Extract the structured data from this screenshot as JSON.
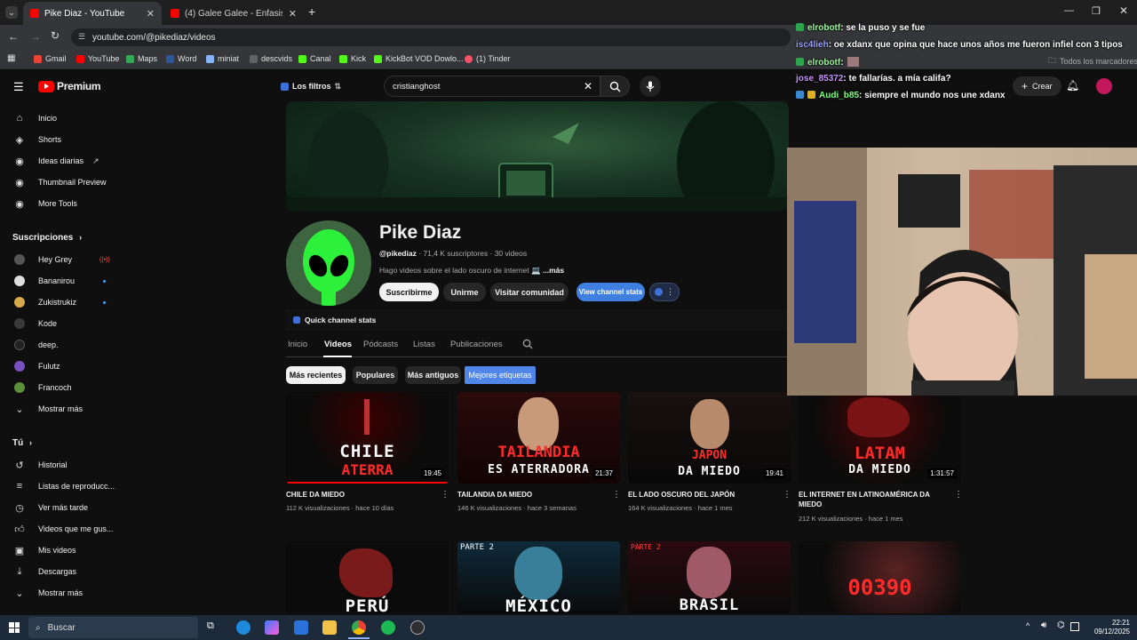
{
  "browser": {
    "tabs": [
      {
        "title": "Pike Diaz - YouTube",
        "active": true
      },
      {
        "title": "(4) Galee Galee - Énfasis (Vídeo",
        "active": false
      }
    ],
    "url": "youtube.com/@pikediaz/videos",
    "bookmarks": [
      "Gmail",
      "YouTube",
      "Maps",
      "Word",
      "miniat",
      "descvids",
      "Canal",
      "Kick",
      "KickBot VOD Dowlo...",
      "(1) Tinder"
    ],
    "all_bookmarks": "Todos los marcadores"
  },
  "youtube": {
    "logo": "Premium",
    "filters_button": "Los filtros",
    "search_value": "cristianghost",
    "create_button": "Crear",
    "sidebar": {
      "main": [
        {
          "label": "Inicio",
          "icon": "home-icon"
        },
        {
          "label": "Shorts",
          "icon": "shorts-icon"
        },
        {
          "label": "Ideas diarias",
          "icon": "ideas-icon"
        },
        {
          "label": "Thumbnail Preview",
          "icon": "thumbnail-icon"
        },
        {
          "label": "More Tools",
          "icon": "tools-icon"
        }
      ],
      "subs_header": "Suscripciones",
      "subs": [
        {
          "label": "Hey Grey",
          "live": true
        },
        {
          "label": "Bananirou",
          "dot": true
        },
        {
          "label": "Zukistrukiz",
          "dot": true
        },
        {
          "label": "Kode"
        },
        {
          "label": "deep."
        },
        {
          "label": "Fulutz"
        },
        {
          "label": "Francoch"
        }
      ],
      "subs_more": "Mostrar más",
      "you_header": "Tú",
      "you": [
        {
          "label": "Historial",
          "icon": "history-icon"
        },
        {
          "label": "Listas de reproducc...",
          "icon": "playlists-icon"
        },
        {
          "label": "Ver más tarde",
          "icon": "watch-later-icon"
        },
        {
          "label": "Videos que me gus...",
          "icon": "like-icon"
        },
        {
          "label": "Mis videos",
          "icon": "my-videos-icon"
        },
        {
          "label": "Descargas",
          "icon": "download-icon"
        }
      ],
      "you_more": "Mostrar más"
    },
    "channel": {
      "name": "Pike Diaz",
      "handle": "@pikediaz",
      "stats": "71,4 K suscriptores · 30 videos",
      "description": "Hago videos sobre el lado oscuro de internet 💻",
      "more": "...más",
      "buttons": {
        "subscribe": "Suscribirme",
        "join": "Unirme",
        "community": "Visitar comunidad",
        "stats": "View channel stats"
      },
      "quick_stats": "Quick channel stats",
      "tabs": [
        "Inicio",
        "Videos",
        "Pódcasts",
        "Listas",
        "Publicaciones"
      ],
      "active_tab": "Videos",
      "sort_chips": [
        "Más recientes",
        "Populares",
        "Más antiguos",
        "Mejores etiquetas"
      ]
    },
    "videos": [
      {
        "title": "CHILE DA MIEDO",
        "meta": "112 K visualizaciones · hace 10 días",
        "duration": "19:45",
        "thumb_top": "CHILE",
        "thumb_bottom": "ATERRA"
      },
      {
        "title": "TAILANDIA DA MIEDO",
        "meta": "146 K visualizaciones · hace 3 semanas",
        "duration": "21:37",
        "thumb_top": "TAILANDIA",
        "thumb_bottom": "ES ATERRADORA"
      },
      {
        "title": "EL LADO OSCURO DEL JAPÓN",
        "meta": "164 K visualizaciones · hace 1 mes",
        "duration": "19:41",
        "thumb_top": "JAPÓN",
        "thumb_bottom": "DA MIEDO"
      },
      {
        "title": "EL INTERNET EN LATINOAMÉRICA DA MIEDO",
        "meta": "212 K visualizaciones · hace 1 mes",
        "duration": "1:31:57",
        "thumb_top": "LATAM",
        "thumb_bottom": "DA MIEDO"
      }
    ],
    "videos_row2": [
      {
        "thumb_text": "PERÚ"
      },
      {
        "thumb_label": "PARTE 2",
        "thumb_text": "MÉXICO"
      },
      {
        "thumb_label": "PARTE 2",
        "thumb_text": "BRASIL"
      },
      {
        "thumb_text": "00390"
      }
    ]
  },
  "stream_overlay": {
    "chat": [
      {
        "user": "elrobotf",
        "msg": ": se la puso y se fue"
      },
      {
        "user": "isc4lieh",
        "msg": ": oe xdanx que opina que hace unos años me fueron infiel con 3 tipos"
      },
      {
        "user": "elrobotf",
        "msg": ":"
      },
      {
        "user": "jose_85372",
        "msg": ": te fallarías. a mía califa?"
      },
      {
        "user": "Audi_b85",
        "msg": ": siempre el mundo nos une xdanx"
      }
    ],
    "chat_user_colors": [
      "#2da44e",
      "#9aa0ff",
      "#2da44e",
      "#c792ff",
      "#7cff7c"
    ]
  },
  "taskbar": {
    "search": "Buscar",
    "time": "22:21",
    "date": "09/12/2025"
  }
}
